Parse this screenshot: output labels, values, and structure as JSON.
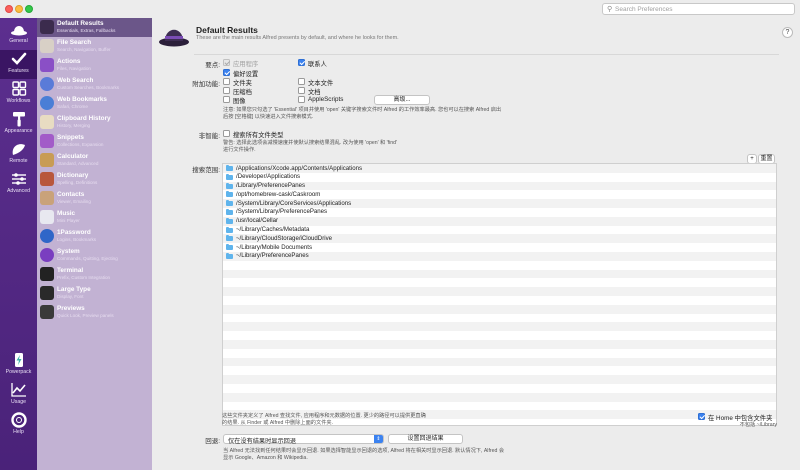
{
  "search": {
    "placeholder": "Search Preferences"
  },
  "main_nav": [
    {
      "label": "General",
      "icon": "hat-icon"
    },
    {
      "label": "Features",
      "icon": "checkmark-icon",
      "active": true
    },
    {
      "label": "Workflows",
      "icon": "grid-icon"
    },
    {
      "label": "Appearance",
      "icon": "paint-roller-icon"
    },
    {
      "label": "Remote",
      "icon": "remote-icon"
    },
    {
      "label": "Advanced",
      "icon": "sliders-icon"
    },
    {
      "label": "Powerpack",
      "icon": "lightning-icon"
    },
    {
      "label": "Usage",
      "icon": "graph-icon"
    },
    {
      "label": "Help",
      "icon": "lifebuoy-icon"
    }
  ],
  "features": [
    {
      "title": "Default Results",
      "subtitle": "Essentials, Extras, Fallbacks",
      "color": "#3b2b4d",
      "selected": true
    },
    {
      "title": "File Search",
      "subtitle": "Search, Navigation, Buffer",
      "color": "#d8d0c6"
    },
    {
      "title": "Actions",
      "subtitle": "Files, Navigation",
      "color": "#8a4fc6"
    },
    {
      "title": "Web Search",
      "subtitle": "Custom Searches, Bookmarks",
      "color": "#5a7bd8"
    },
    {
      "title": "Web Bookmarks",
      "subtitle": "Safari, Chrome",
      "color": "#4a7ed6"
    },
    {
      "title": "Clipboard History",
      "subtitle": "History, Merging",
      "color": "#e8dcc2"
    },
    {
      "title": "Snippets",
      "subtitle": "Collections, Expansion",
      "color": "#a25bc8"
    },
    {
      "title": "Calculator",
      "subtitle": "Standard, Advanced",
      "color": "#c89c55"
    },
    {
      "title": "Dictionary",
      "subtitle": "Spelling, Definitions",
      "color": "#b8563c"
    },
    {
      "title": "Contacts",
      "subtitle": "Viewer, Emailing",
      "color": "#c9a27a"
    },
    {
      "title": "Music",
      "subtitle": "Mini Player",
      "color": "#e8e8f0"
    },
    {
      "title": "1Password",
      "subtitle": "Logins, Bookmarks",
      "color": "#2f66c8"
    },
    {
      "title": "System",
      "subtitle": "Commands, Quitting, Ejecting",
      "color": "#7a3ec0"
    },
    {
      "title": "Terminal",
      "subtitle": "Prefix, Custom Integration",
      "color": "#222222"
    },
    {
      "title": "Large Type",
      "subtitle": "Display, Font",
      "color": "#2a2a2a"
    },
    {
      "title": "Previews",
      "subtitle": "Quick Look, Preview panels",
      "color": "#3a3a3a"
    }
  ],
  "header": {
    "title": "Default Results",
    "subtitle": "These are the main results Alfred presents by default, and where he looks for them.",
    "help": "?"
  },
  "essentials": {
    "label": "要点:",
    "items": [
      {
        "label": "应用程序",
        "checked": true,
        "disabled": true
      },
      {
        "label": "联系人",
        "checked": true
      },
      {
        "label": "偏好设置",
        "checked": true
      }
    ]
  },
  "extras": {
    "label": "附加功能:",
    "items": [
      {
        "label": "文件夹",
        "checked": false
      },
      {
        "label": "文本文件",
        "checked": false
      },
      {
        "label": "压缩档",
        "checked": false
      },
      {
        "label": "文档",
        "checked": false
      },
      {
        "label": "图像",
        "checked": false
      },
      {
        "label": "AppleScripts",
        "checked": false
      }
    ],
    "advanced_button": "高级...",
    "note_line1": "注意: 如果您只勾选了 'Essential' 项目并使用 'open' 关键字搜索文件时 Alfred 的工作效率最高. 您也可以在搜索 Alfred 启出",
    "note_line2": "后按 [空格键] 以快速进入文件搜索模式."
  },
  "intelligent": {
    "label": "非智能:",
    "checkbox": "搜索所有文件类型",
    "checked": false,
    "note_line1": "警告: 选择此选项会减慢速度并使默认搜索结果混乱. 改为使用 'open' 和 'find'",
    "note_line2": "进行文件操作."
  },
  "scope": {
    "label": "搜索范围:",
    "add_button": "+",
    "reset_button": "重置",
    "paths": [
      "/Applications/Xcode.app/Contents/Applications",
      "/Developer/Applications",
      "/Library/PreferencePanes",
      "/opt/homebrew-cask/Caskroom",
      "/System/Library/CoreServices/Applications",
      "/System/Library/PreferencePanes",
      "/usr/local/Cellar",
      "~/Library/Caches/Metadata",
      "~/Library/CloudStorage/iCloudDrive",
      "~/Library/Mobile Documents",
      "~/Library/PreferencePanes"
    ],
    "note_line1": "这些文件夹定义了 Alfred 查找文件, 应用程序和元数据的位置. 更少的路径可以提供更直确",
    "note_line2": "的结果. 从 Finder 或 Alfred 中删除上面的文件夹.",
    "home_checkbox": "在 Home 中包含文件夹",
    "home_checked": true,
    "home_sub": "不包括 ~/Library"
  },
  "fallback": {
    "label": "回退:",
    "select_value": "仅在没有结果时显示回退",
    "button": "设置回退结果",
    "note_line1": "当 Alfred 无法找到任何结果时会显示回退. 如果选择智能显示回退的选项, Alfred 将在相关时显示回退. 默认情况下, Alfred 会",
    "note_line2": "显示 Google、Amazon 和 Wikipedia."
  }
}
